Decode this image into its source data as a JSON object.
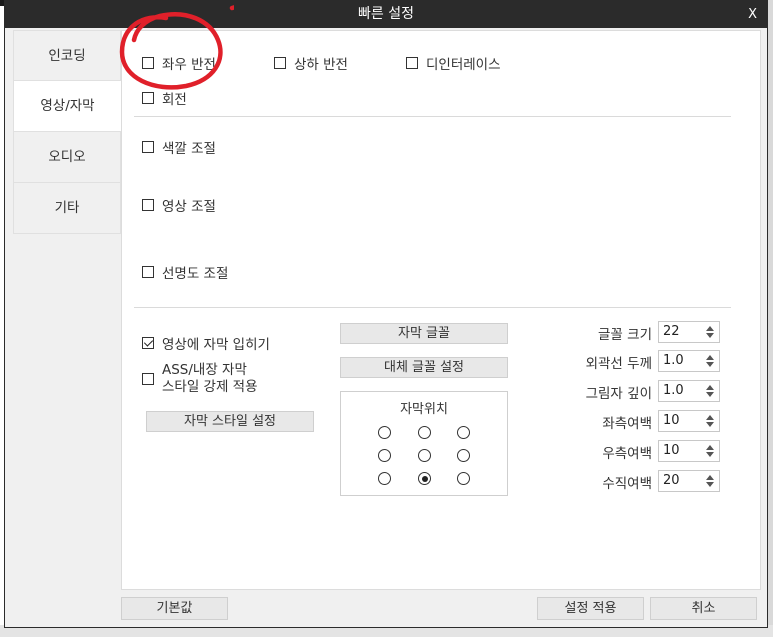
{
  "window": {
    "title": "빠른 설정",
    "close_label": "X"
  },
  "tabs": [
    {
      "label": "인코딩",
      "active": false
    },
    {
      "label": "영상/자막",
      "active": true
    },
    {
      "label": "오디오",
      "active": false
    },
    {
      "label": "기타",
      "active": false
    }
  ],
  "video": {
    "flip_horizontal": {
      "label": "좌우 반전",
      "checked": false
    },
    "flip_vertical": {
      "label": "상하 반전",
      "checked": false
    },
    "deinterlace": {
      "label": "디인터레이스",
      "checked": false
    },
    "rotate": {
      "label": "회전",
      "checked": false
    },
    "color_adjust": {
      "label": "색깔 조절",
      "checked": false
    },
    "image_adjust": {
      "label": "영상 조절",
      "checked": false
    },
    "sharpness_adjust": {
      "label": "선명도 조절",
      "checked": false
    }
  },
  "subtitle": {
    "burn_in": {
      "label": "영상에 자막 입히기",
      "checked": true
    },
    "force_style": {
      "label_line1": "ASS/내장 자막",
      "label_line2": "스타일 강제 적용",
      "checked": false
    },
    "style_button": "자막 스타일 설정",
    "font_button": "자막 글꼴",
    "fallback_font_button": "대체 글꼴 설정",
    "position": {
      "title": "자막위치",
      "selected": 7
    },
    "fields": [
      {
        "key": "font_size",
        "label": "글꼴 크기",
        "value": "22"
      },
      {
        "key": "outline",
        "label": "외곽선 두께",
        "value": "1.0"
      },
      {
        "key": "shadow",
        "label": "그림자 깊이",
        "value": "1.0"
      },
      {
        "key": "margin_left",
        "label": "좌측여백",
        "value": "10"
      },
      {
        "key": "margin_right",
        "label": "우측여백",
        "value": "10"
      },
      {
        "key": "margin_vertical",
        "label": "수직여백",
        "value": "20"
      }
    ]
  },
  "footer": {
    "default_button": "기본값",
    "apply_button": "설정 적용",
    "cancel_button": "취소"
  },
  "colors": {
    "titlebar": "#2b2b2b",
    "annotation": "#e0202a"
  }
}
